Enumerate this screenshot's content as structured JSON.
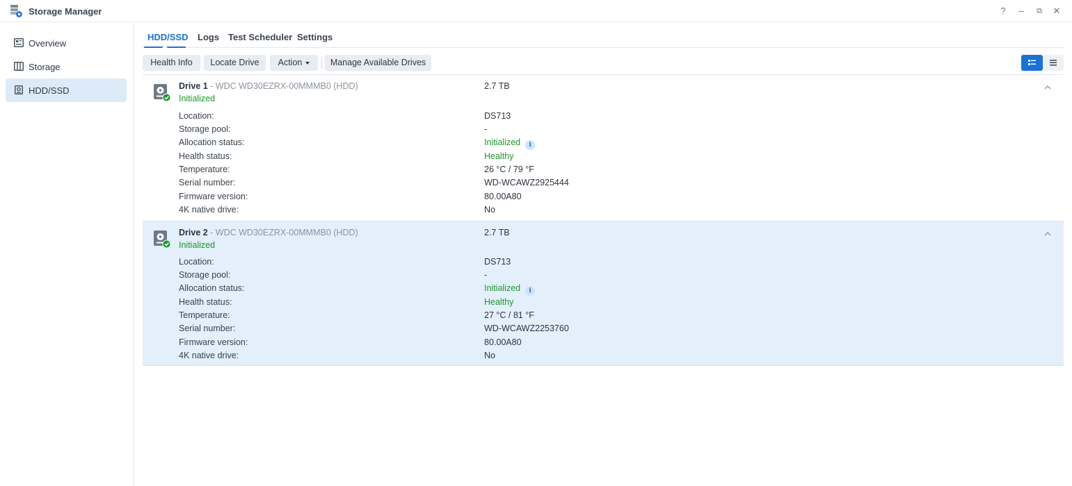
{
  "window": {
    "title": "Storage Manager",
    "buttons": {
      "help": "?",
      "minimize": "–",
      "restore": "⧉",
      "close": "✕"
    }
  },
  "sidebar": {
    "items": [
      {
        "label": "Overview",
        "icon": "overview-icon",
        "active": false
      },
      {
        "label": "Storage",
        "icon": "storage-icon",
        "active": false
      },
      {
        "label": "HDD/SSD",
        "icon": "hdd-icon",
        "active": true
      }
    ]
  },
  "tabs": [
    {
      "label": "HDD/SSD",
      "active": true
    },
    {
      "label": "Logs",
      "active": false
    },
    {
      "label": "Test Scheduler",
      "active": false
    },
    {
      "label": "Settings",
      "active": false
    }
  ],
  "toolbar": {
    "health_info": "Health Info",
    "locate_drive": "Locate Drive",
    "action": "Action",
    "manage_drives": "Manage Available Drives",
    "view_modes": [
      "detail-view-icon",
      "list-view-icon"
    ],
    "active_view": "detail-view-icon"
  },
  "field_labels": [
    "Location:",
    "Storage pool:",
    "Allocation status:",
    "Health status:",
    "Temperature:",
    "Serial number:",
    "Firmware version:",
    "4K native drive:"
  ],
  "drives": [
    {
      "name": "Drive 1",
      "model": " - WDC WD30EZRX-00MMMB0 (HDD)",
      "status": "Initialized",
      "size": "2.7 TB",
      "selected": false,
      "values": [
        "DS713",
        "-",
        "Initialized",
        "Healthy",
        "26 °C / 79 °F",
        "WD-WCAWZ2925444",
        "80.00A80",
        "No"
      ]
    },
    {
      "name": "Drive 2",
      "model": " - WDC WD30EZRX-00MMMB0 (HDD)",
      "status": "Initialized",
      "size": "2.7 TB",
      "selected": true,
      "values": [
        "DS713",
        "-",
        "Initialized",
        "Healthy",
        "27 °C / 81 °F",
        "WD-WCAWZ2253760",
        "80.00A80",
        "No"
      ]
    }
  ],
  "colors": {
    "accent": "#1a72d6",
    "ok_green": "#1a9a26",
    "selection": "#e3effb"
  }
}
